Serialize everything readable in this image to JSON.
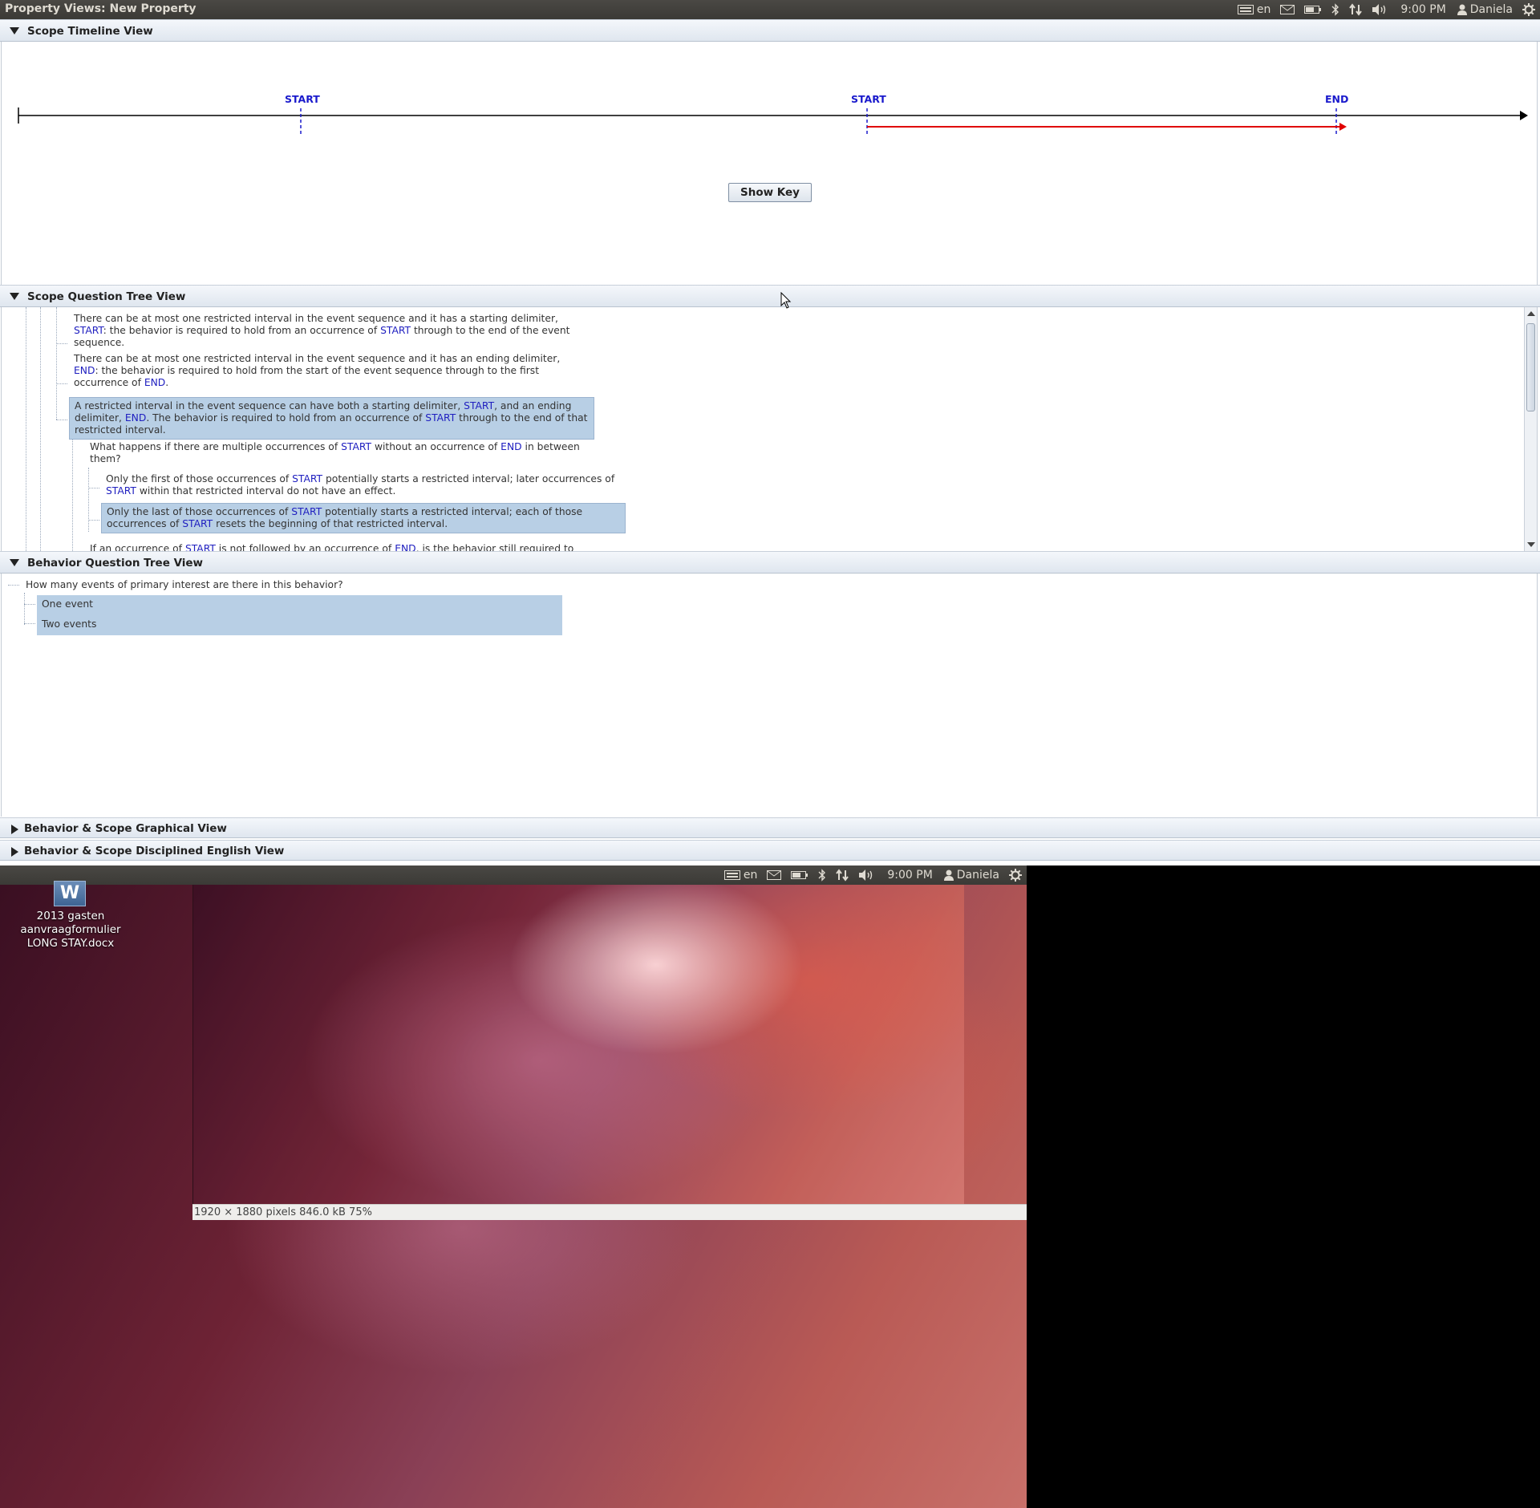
{
  "window": {
    "title": "Property Views: New Property"
  },
  "tray": {
    "language": "en",
    "time": "9:00 PM",
    "user": "Daniela",
    "icons": [
      "keyboard-icon",
      "mail-icon",
      "battery-icon",
      "bluetooth-icon",
      "network-icon",
      "volume-icon",
      "user-icon",
      "gear-icon"
    ]
  },
  "sections": {
    "scope_timeline": "Scope Timeline View",
    "scope_question": "Scope Question Tree View",
    "behavior_question": "Behavior Question Tree View",
    "graphical": "Behavior & Scope Graphical View",
    "english": "Behavior & Scope Disciplined English View"
  },
  "timeline": {
    "markers": [
      "START",
      "START",
      "END"
    ],
    "show_key": "Show Key",
    "colors": {
      "axis": "#000000",
      "marker": "#1a1acc",
      "interval": "#e00000"
    }
  },
  "scope_tree": {
    "n1": {
      "p1": "There can be at most one restricted interval in the event sequence and it has a starting delimiter,",
      "k1": "START",
      "p2": ": the behavior is required to hold from an occurrence of",
      "k2": "START",
      "p3": "through to the end of the event sequence."
    },
    "n2": {
      "p1": "There can be at most one restricted interval in the event sequence and it has an ending delimiter,",
      "k1": "END",
      "p2": ": the behavior is required to hold from the start of the event sequence through to the first occurrence of",
      "k2": "END",
      "p3": "."
    },
    "n3": {
      "p1": "A restricted interval in the event sequence can have both a starting delimiter,",
      "k1": "START",
      "p2": ", and an ending delimiter,",
      "k2": "END",
      "p3": ". The behavior is required to hold from an occurrence of",
      "k3": "START",
      "p4": "through to the end of that restricted interval."
    },
    "n4": {
      "p1": "What happens if there are multiple occurrences of",
      "k1": "START",
      "p2": "without an occurrence of",
      "k2": "END",
      "p3": "in between them?"
    },
    "n5": {
      "p1": "Only the first of those occurrences of",
      "k1": "START",
      "p2": "potentially starts a restricted interval; later occurrences of",
      "k2": "START",
      "p3": "within that restricted interval do not have an effect."
    },
    "n6": {
      "p1": "Only the last of those occurrences of",
      "k1": "START",
      "p2": "potentially starts a restricted interval; each of those occurrences of",
      "k2": "START",
      "p3": "resets the beginning of that restricted interval."
    },
    "n7": {
      "p1": "If an occurrence of",
      "k1": "START",
      "p2": "is not followed by an occurrence of",
      "k2": "END",
      "p3": ", is the behavior still required to"
    }
  },
  "behavior_tree": {
    "question": "How many events of primary interest are there in this behavior?",
    "answers": [
      "One event",
      "Two events"
    ]
  },
  "desktop": {
    "file_icon_letter": "W",
    "file_name": "2013 gasten aanvraagformulier LONG STAY.docx",
    "status": "1920 × 1880 pixels  846.0 kB   75%"
  }
}
